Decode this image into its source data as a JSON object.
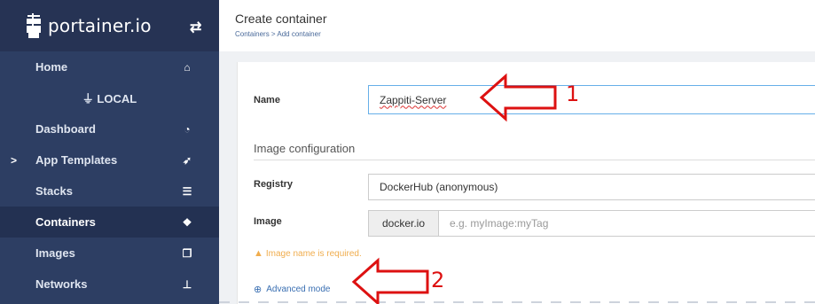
{
  "brand": {
    "name": "portainer.io"
  },
  "sidebar": {
    "items": [
      {
        "label": "Home",
        "icon": "home-icon"
      },
      {
        "label": "LOCAL",
        "icon": "plug-icon"
      },
      {
        "label": "Dashboard",
        "icon": "dashboard-icon"
      },
      {
        "label": "App Templates",
        "icon": "rocket-icon"
      },
      {
        "label": "Stacks",
        "icon": "list-icon"
      },
      {
        "label": "Containers",
        "icon": "cubes-icon"
      },
      {
        "label": "Images",
        "icon": "clone-icon"
      },
      {
        "label": "Networks",
        "icon": "sitemap-icon"
      }
    ]
  },
  "header": {
    "title": "Create container",
    "breadcrumb": "Containers > Add container"
  },
  "form": {
    "name_label": "Name",
    "name_value": "Zappiti-Server",
    "image_config_title": "Image configuration",
    "registry_label": "Registry",
    "registry_value": "DockerHub (anonymous)",
    "image_label": "Image",
    "image_prefix": "docker.io",
    "image_placeholder": "e.g. myImage:myTag",
    "warning": "Image name is required.",
    "advanced_mode": "Advanced mode"
  },
  "annotations": {
    "first": "1",
    "second": "2"
  },
  "colors": {
    "sidebar": "#2d3e63",
    "accent": "#3a6fb2",
    "warning": "#f0ad4e",
    "annotation": "#dd1111"
  }
}
